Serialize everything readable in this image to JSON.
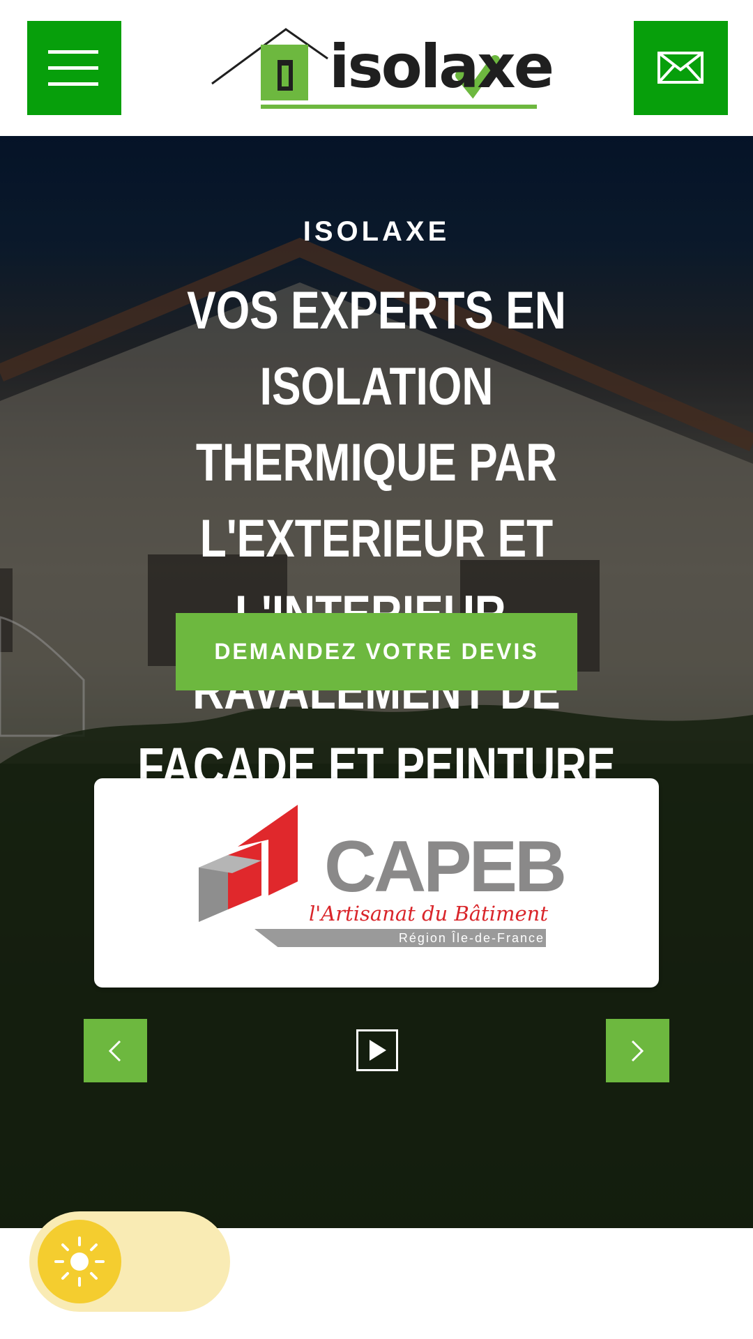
{
  "header": {
    "menu_icon": "hamburger-menu-icon",
    "logo_text": "isolaxe",
    "contact_icon": "envelope-icon",
    "brand_color": "#079f0b"
  },
  "hero": {
    "eyebrow": "ISOLAXE",
    "headline": "VOS EXPERTS EN ISOLATION THERMIQUE PAR L'EXTERIEUR ET L'INTERIEUR, RAVALEMENT DE FAÇADE ET PEINTURE",
    "cta_label": "DEMANDEZ VOTRE DEVIS",
    "accent_color": "#6db83f"
  },
  "partner_carousel": {
    "current": {
      "name": "CAPEB",
      "tagline": "l'Artisanat du Bâtiment",
      "region": "Région Île-de-France"
    },
    "prev_icon": "chevron-left-icon",
    "next_icon": "chevron-right-icon",
    "play_icon": "play-icon"
  },
  "accessibility": {
    "toggle_icon": "sun-icon",
    "toggle_color": "#f4cd2f"
  }
}
